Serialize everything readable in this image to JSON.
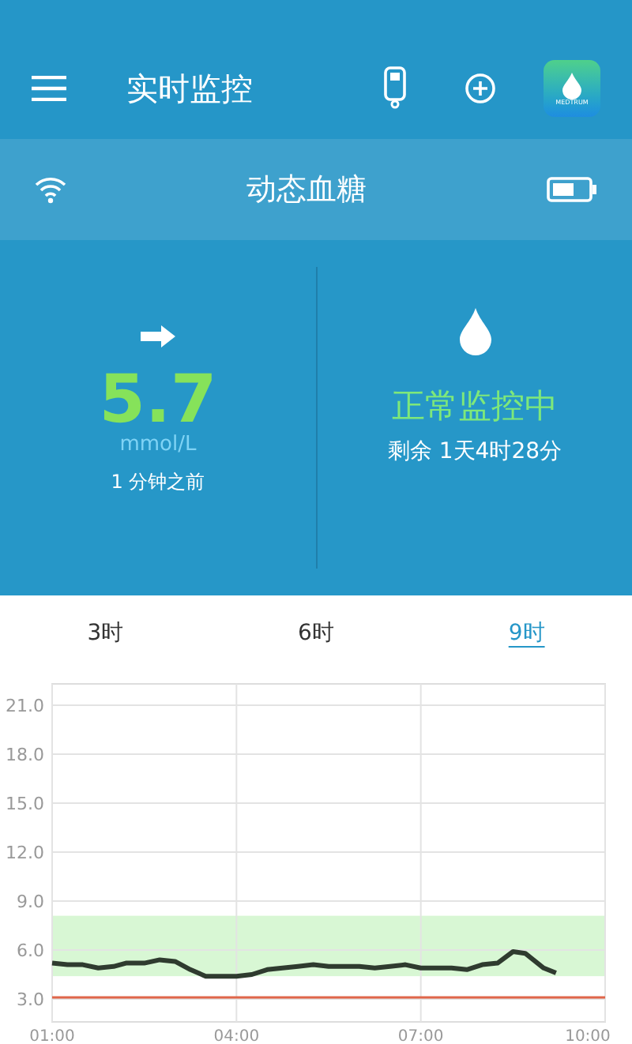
{
  "header": {
    "title": "实时监控",
    "app_logo_text": "MEDTRUM"
  },
  "sub_bar": {
    "title": "动态血糖"
  },
  "reading": {
    "value": "5.7",
    "unit": "mmol/L",
    "time": "1 分钟之前"
  },
  "status": {
    "title": "正常监控中",
    "remaining": "剩余 1天4时28分"
  },
  "tabs": [
    {
      "label": "3时",
      "selected": false
    },
    {
      "label": "6时",
      "selected": false
    },
    {
      "label": "9时",
      "selected": true
    }
  ],
  "chart": {
    "chart_data": {
      "type": "line",
      "x": [
        1,
        1.25,
        1.5,
        1.75,
        2,
        2.2,
        2.5,
        2.75,
        3,
        3.25,
        3.5,
        3.75,
        4,
        4.25,
        4.5,
        4.75,
        5,
        5.25,
        5.5,
        6,
        6.25,
        6.5,
        6.75,
        7,
        7.5,
        7.75,
        8,
        8.25,
        8.5,
        8.7,
        9,
        9.2
      ],
      "series": [
        {
          "color": "#2f3b2f",
          "values": [
            5.2,
            5.1,
            5.1,
            4.9,
            5.0,
            5.2,
            5.2,
            5.4,
            5.3,
            4.8,
            4.4,
            4.4,
            4.4,
            4.5,
            4.8,
            4.9,
            5.0,
            5.1,
            5.0,
            5.0,
            4.9,
            5.0,
            5.1,
            4.9,
            4.9,
            4.8,
            5.1,
            5.2,
            5.9,
            5.8,
            4.9,
            4.6
          ]
        }
      ],
      "xlim": [
        1,
        10
      ],
      "ylim": [
        1.6,
        22.3
      ],
      "xticks": [
        {
          "value": 1,
          "label": "01:00"
        },
        {
          "value": 4,
          "label": "04:00"
        },
        {
          "value": 7,
          "label": "07:00"
        },
        {
          "value": 10,
          "label": "10:00"
        }
      ],
      "yticks": [
        {
          "value": 3,
          "label": "3.0"
        },
        {
          "value": 6,
          "label": "6.0"
        },
        {
          "value": 9,
          "label": "9.0"
        },
        {
          "value": 12,
          "label": "12.0"
        },
        {
          "value": 15,
          "label": "15.0"
        },
        {
          "value": 18,
          "label": "18.0"
        },
        {
          "value": 21,
          "label": "21.0"
        }
      ],
      "grid": true,
      "bands": [
        {
          "axis": "y",
          "from": 4.4,
          "to": 8.1,
          "color": "#d8f7d4"
        }
      ],
      "ref_lines": [
        {
          "axis": "y",
          "value": 3.1,
          "color": "#e0664a"
        }
      ]
    }
  }
}
